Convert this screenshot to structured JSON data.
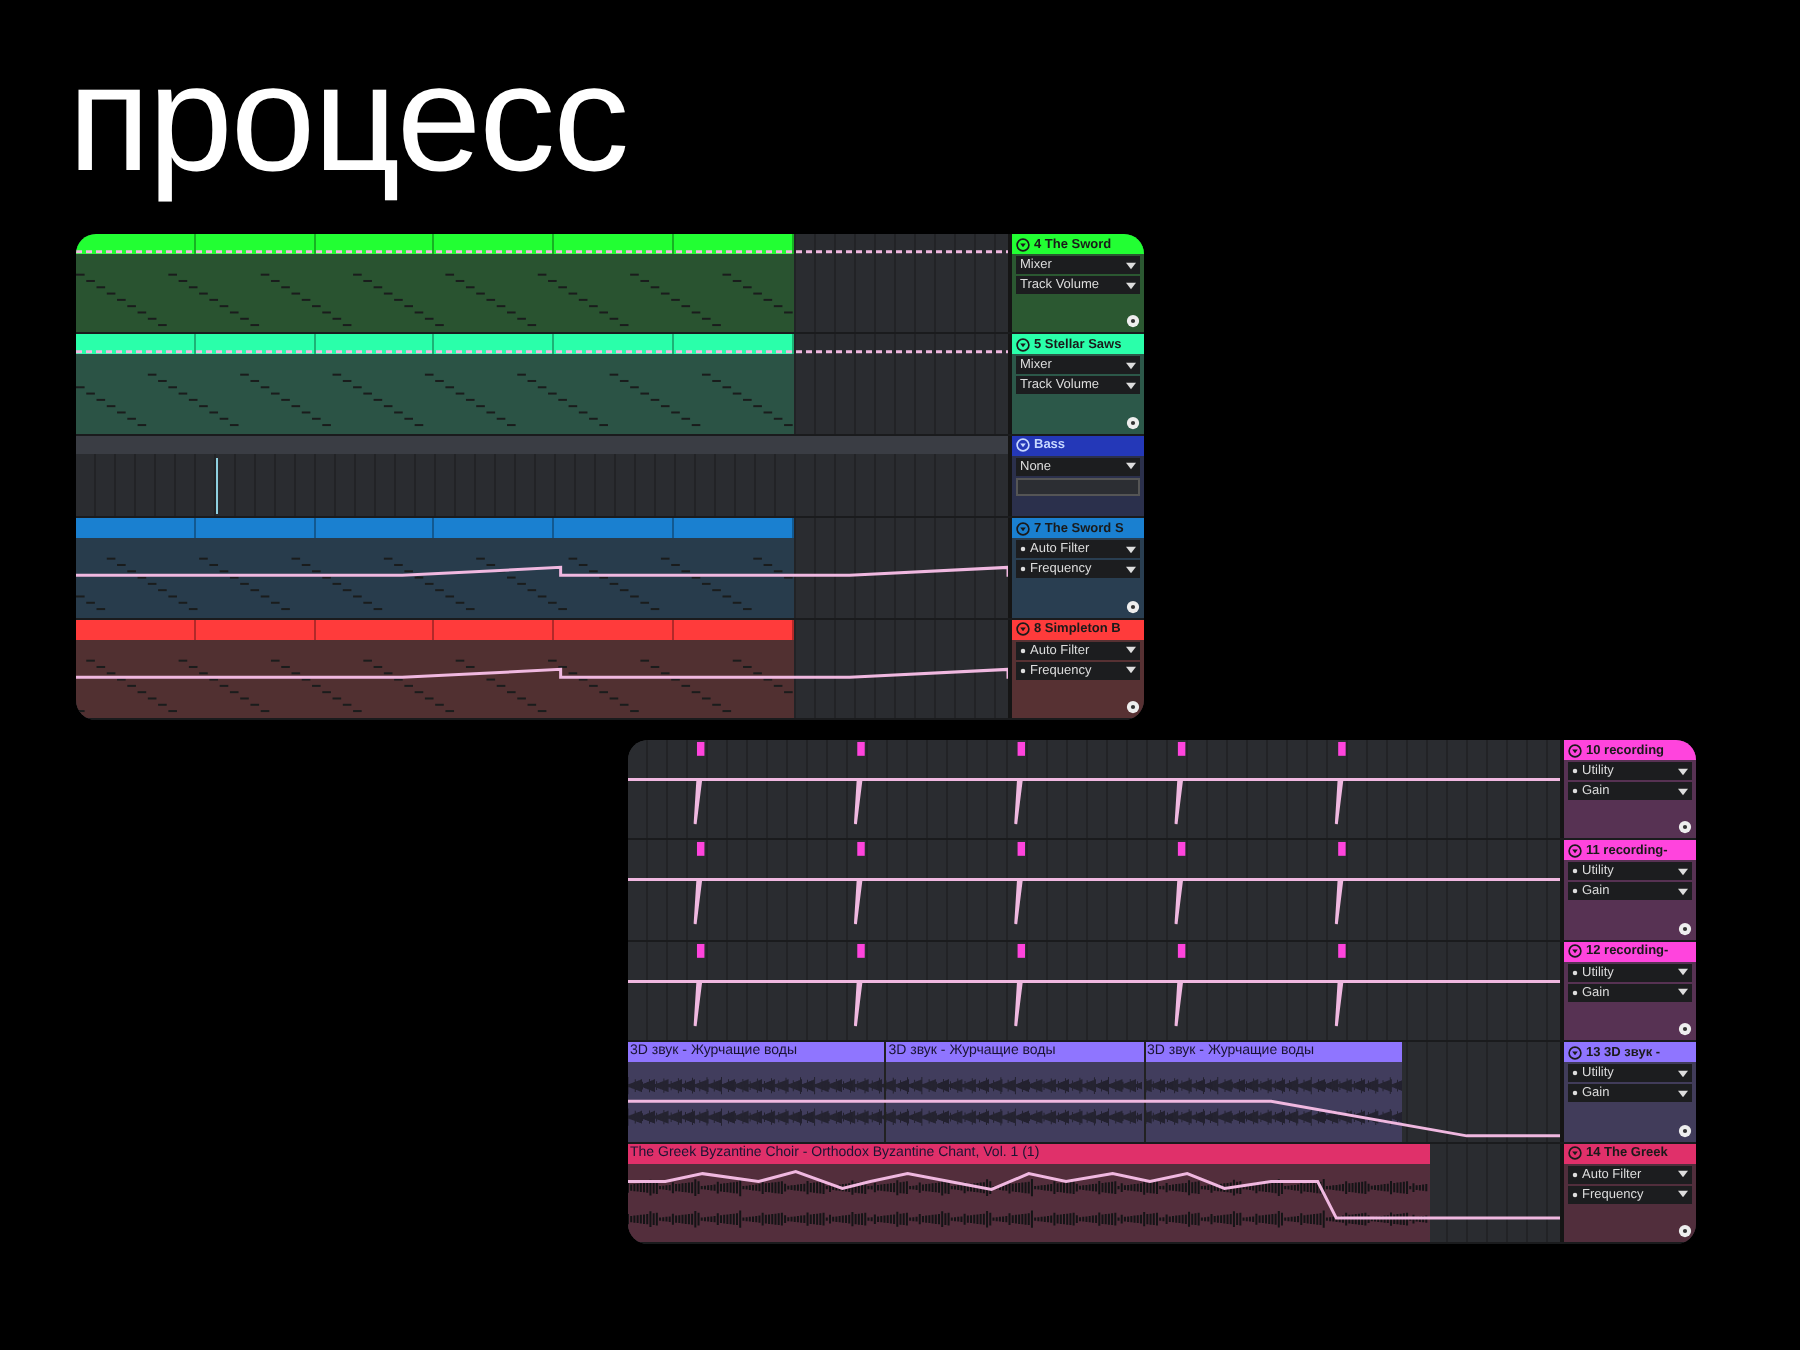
{
  "title": "процесс",
  "screens": [
    {
      "tracks": [
        {
          "kind": "midi",
          "name": "4 The Sword",
          "color": "#22ff33",
          "device": "Mixer",
          "device_active": false,
          "parameter": "Track Volume",
          "parameter_active": false,
          "automation": {
            "kind": "dashed"
          }
        },
        {
          "kind": "midi",
          "name": "5 Stellar Saws",
          "color": "#2affaa",
          "device": "Mixer",
          "device_active": false,
          "parameter": "Track Volume",
          "parameter_active": false,
          "automation": {
            "kind": "dashed"
          }
        },
        {
          "kind": "empty",
          "name": "Bass",
          "color": "#2438b8",
          "device": "None",
          "device_active": false
        },
        {
          "kind": "midi",
          "name": "7 The Sword S",
          "color": "#1a80d0",
          "device": "Auto Filter",
          "device_active": true,
          "parameter": "Frequency",
          "parameter_active": true,
          "automation": {
            "kind": "ramp"
          }
        },
        {
          "kind": "midi",
          "name": "8 Simpleton B",
          "color": "#ff3b3b",
          "device": "Auto Filter",
          "device_active": true,
          "parameter": "Frequency",
          "parameter_active": true,
          "automation": {
            "kind": "ramp"
          }
        }
      ]
    },
    {
      "tracks": [
        {
          "kind": "automation",
          "name": "10 recording",
          "color": "#ff44dd",
          "device": "Utility",
          "device_active": true,
          "parameter": "Gain",
          "parameter_active": true,
          "automation": {
            "kind": "spikes"
          }
        },
        {
          "kind": "automation",
          "name": "11 recording-",
          "color": "#ff44dd",
          "device": "Utility",
          "device_active": true,
          "parameter": "Gain",
          "parameter_active": true,
          "automation": {
            "kind": "spikes"
          }
        },
        {
          "kind": "automation",
          "name": "12 recording-",
          "color": "#ff44dd",
          "device": "Utility",
          "device_active": true,
          "parameter": "Gain",
          "parameter_active": true,
          "automation": {
            "kind": "spikes"
          }
        },
        {
          "kind": "audio",
          "name": "13 3D звук -",
          "color": "#8f75ff",
          "device": "Utility",
          "device_active": true,
          "parameter": "Gain",
          "parameter_active": true,
          "automation": {
            "kind": "fade"
          },
          "clips": [
            {
              "label": "3D звук - Журчащие воды"
            },
            {
              "label": "3D звук - Журчащие воды"
            },
            {
              "label": "3D звук - Журчащие воды"
            }
          ]
        },
        {
          "kind": "audio",
          "name": "14 The Greek",
          "color": "#e0306a",
          "device": "Auto Filter",
          "device_active": true,
          "parameter": "Frequency",
          "parameter_active": true,
          "automation": {
            "kind": "zigzag"
          },
          "clips": [
            {
              "label": "The Greek Byzantine Choir - Orthodox Byzantine Chant, Vol. 1 (1)"
            }
          ]
        }
      ]
    }
  ]
}
